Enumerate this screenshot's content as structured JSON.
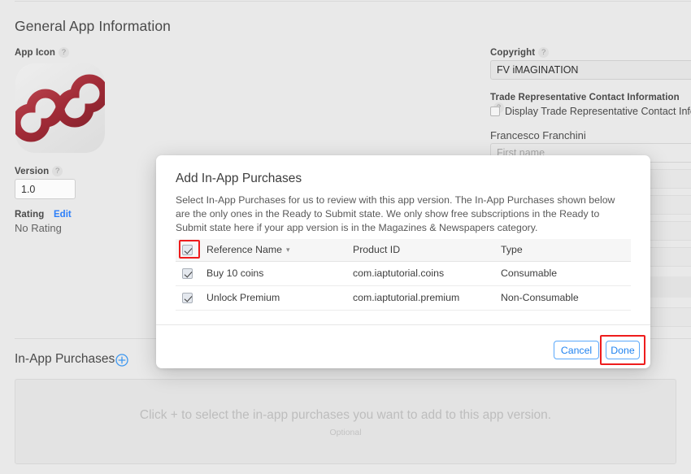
{
  "page": {
    "title": "General App Information"
  },
  "left": {
    "app_icon_label": "App Icon",
    "help": "?",
    "app_icon_name": "app-logo-infinity",
    "version_label": "Version",
    "version_value": "1.0",
    "rating_label": "Rating",
    "rating_edit": "Edit",
    "rating_value": "No Rating"
  },
  "right": {
    "copyright_label": "Copyright",
    "copyright_value": "FV iMAGINATION",
    "trade_label": "Trade Representative Contact Information",
    "trade_checkbox_text": "Display Trade Representative Contact Inform",
    "person_name": "Francesco Franchini",
    "first_name_placeholder": "First name",
    "first_name_value": ""
  },
  "iap_section": {
    "heading": "In-App Purchases",
    "add_icon": "plus-circle-icon",
    "dropzone_text": "Click + to select the in-app purchases you want to add to this app version.",
    "dropzone_sub": "Optional"
  },
  "modal": {
    "title": "Add In-App Purchases",
    "description": "Select In-App Purchases for us to review with this app version. The In-App Purchases shown below are the only ones in the Ready to Submit state. We only show free subscriptions in the Ready to Submit state here if your app version is in the Magazines & Newspapers category.",
    "table": {
      "headers": {
        "select_all": "",
        "reference_name": "Reference Name",
        "sort_icon": "chevron-down-icon",
        "product_id": "Product ID",
        "type": "Type"
      },
      "rows": [
        {
          "checked": true,
          "reference_name": "Buy 10 coins",
          "product_id": "com.iaptutorial.coins",
          "type": "Consumable"
        },
        {
          "checked": true,
          "reference_name": "Unlock Premium",
          "product_id": "com.iaptutorial.premium",
          "type": "Non-Consumable"
        }
      ]
    },
    "cancel_label": "Cancel",
    "done_label": "Done"
  },
  "colors": {
    "accent_blue": "#1f82f0",
    "highlight_red": "#ee1c1c",
    "page_bg": "#e9e9e9",
    "logo_red": "#a8303c"
  }
}
